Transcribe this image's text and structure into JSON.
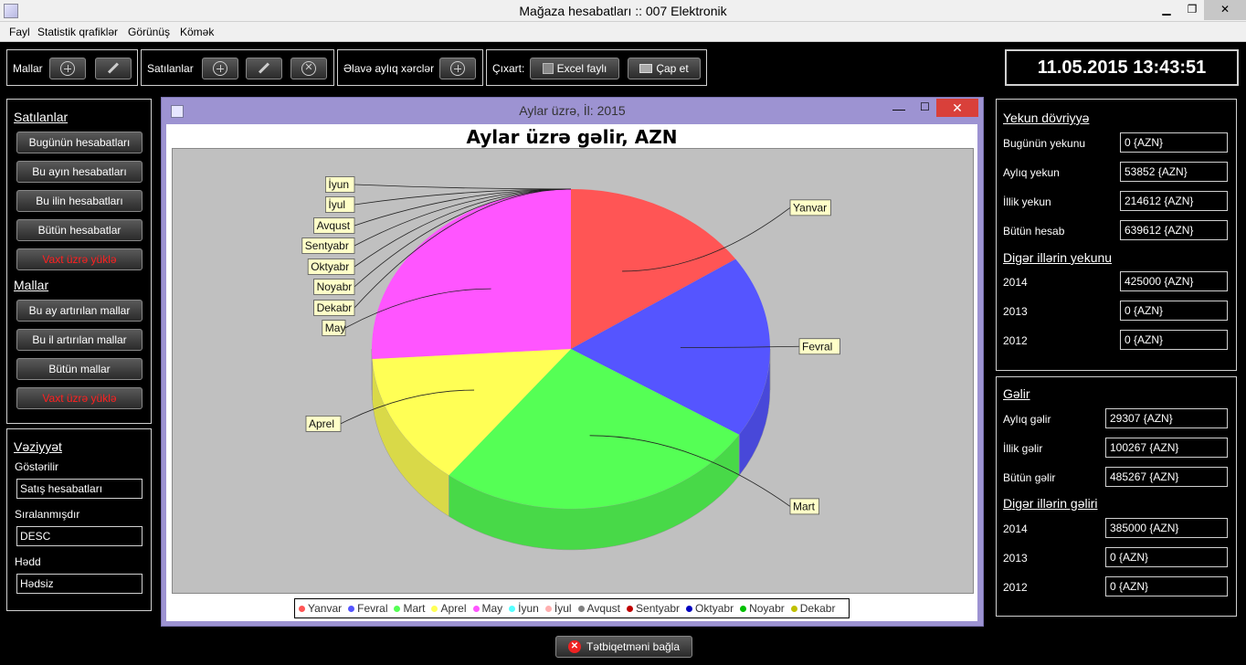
{
  "window": {
    "title": "Mağaza hesabatları :: 007 Elektronik",
    "minimize": "▁",
    "maximize": "❐",
    "close": "✕"
  },
  "menu": [
    "Fayl",
    "Statistik qrafiklər",
    "Görünüş",
    "Kömək"
  ],
  "toolbar": {
    "mallar_label": "Mallar",
    "satilanlar_label": "Satılanlar",
    "xerc_label": "Əlavə aylıq xərclər",
    "cixart_label": "Çıxart:",
    "excel_label": "Excel faylı",
    "print_label": "Çap et"
  },
  "clock": "11.05.2015 13:43:51",
  "left": {
    "satilanlar_title": "Satılanlar",
    "satilanlar_buttons": [
      "Bugünün hesabatları",
      "Bu ayın hesabatları",
      "Bu ilin hesabatları",
      "Bütün hesabatlar",
      "Vaxt üzrə yüklə"
    ],
    "mallar_title": "Mallar",
    "mallar_buttons": [
      "Bu ay artırılan mallar",
      "Bu il artırılan mallar",
      "Bütün mallar",
      "Vaxt üzrə yüklə"
    ],
    "status_title": "Vəziyyət",
    "shown_label": "Göstərilir",
    "shown_value": "Satış hesabatları",
    "sorted_label": "Sıralanmışdır",
    "sorted_value": "DESC",
    "limit_label": "Hədd",
    "limit_value": "Hədsiz"
  },
  "chart_window": {
    "title": "Aylar üzrə, İl: 2015",
    "minimize": "—",
    "maximize": "☐",
    "close": "✕"
  },
  "chart_data": {
    "type": "pie",
    "title": "Aylar üzrə gəlir, AZN",
    "categories": [
      "Yanvar",
      "Fevral",
      "Mart",
      "Aprel",
      "May",
      "İyun",
      "İyul",
      "Avqust",
      "Sentyabr",
      "Oktyabr",
      "Noyabr",
      "Dekabr"
    ],
    "values": [
      15.5,
      18.5,
      26.5,
      13.5,
      26,
      0,
      0,
      0,
      0,
      0,
      0,
      0
    ],
    "value_unit": "percent (estimated)",
    "legend_position": "bottom",
    "colors": [
      "#ff5555",
      "#5555ff",
      "#55ff55",
      "#ffff55",
      "#ff55ff",
      "#55ffff",
      "#ffafaf",
      "#808080",
      "#c00000",
      "#0000c0",
      "#00c000",
      "#c0c000"
    ]
  },
  "right": {
    "yekun_title": "Yekun dövriyyə",
    "yekun_rows": [
      {
        "label": "Bugünün yekunu",
        "value": "0 {AZN}"
      },
      {
        "label": "Aylıq yekun",
        "value": "53852 {AZN}"
      },
      {
        "label": "İllik yekun",
        "value": "214612 {AZN}"
      },
      {
        "label": "Bütün hesab",
        "value": "639612 {AZN}"
      }
    ],
    "diger_yekun_title": "Digər illərin yekunu",
    "diger_yekun_rows": [
      {
        "label": "2014",
        "value": "425000 {AZN}"
      },
      {
        "label": "2013",
        "value": "0 {AZN}"
      },
      {
        "label": "2012",
        "value": "0 {AZN}"
      }
    ],
    "gelir_title": "Gəlir",
    "gelir_rows": [
      {
        "label": "Aylıq gəlir",
        "value": "29307 {AZN}"
      },
      {
        "label": "İllik gəlir",
        "value": "100267 {AZN}"
      },
      {
        "label": "Bütün gəlir",
        "value": "485267 {AZN}"
      }
    ],
    "diger_gelir_title": "Digər illərin gəliri",
    "diger_gelir_rows": [
      {
        "label": "2014",
        "value": "385000 {AZN}"
      },
      {
        "label": "2013",
        "value": "0 {AZN}"
      },
      {
        "label": "2012",
        "value": "0 {AZN}"
      }
    ]
  },
  "bottom": {
    "close_app_label": "Tətbiqetməni bağla"
  }
}
